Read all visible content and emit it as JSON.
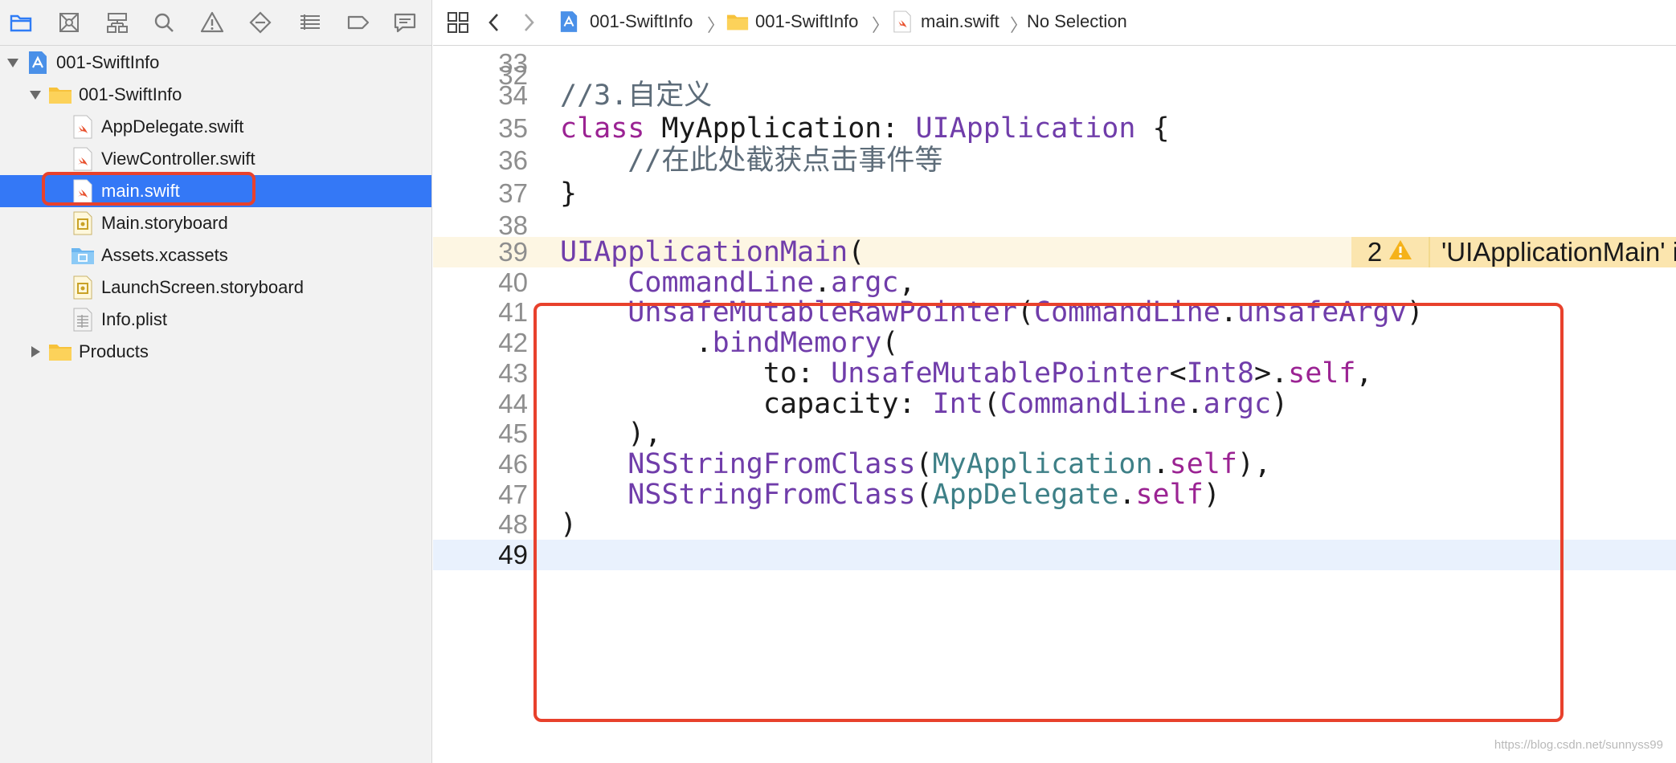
{
  "navigator": {
    "toolbar_icons": [
      "folder-icon",
      "source-control-icon",
      "hierarchy-icon",
      "search-icon",
      "warning-icon",
      "breakpoint-icon",
      "debug-list-icon",
      "tag-icon",
      "chat-icon"
    ],
    "tree": [
      {
        "label": "001-SwiftInfo",
        "icon": "project-icon",
        "disclosure": "expanded"
      },
      {
        "label": "001-SwiftInfo",
        "icon": "folder-icon",
        "disclosure": "expanded"
      },
      {
        "label": "AppDelegate.swift",
        "icon": "swift-file-icon"
      },
      {
        "label": "ViewController.swift",
        "icon": "swift-file-icon"
      },
      {
        "label": "main.swift",
        "icon": "swift-file-icon",
        "selected": true
      },
      {
        "label": "Main.storyboard",
        "icon": "storyboard-icon"
      },
      {
        "label": "Assets.xcassets",
        "icon": "asset-catalog-icon"
      },
      {
        "label": "LaunchScreen.storyboard",
        "icon": "storyboard-icon"
      },
      {
        "label": "Info.plist",
        "icon": "plist-icon"
      },
      {
        "label": "Products",
        "icon": "folder-icon",
        "disclosure": "collapsed"
      }
    ]
  },
  "jumpbar": {
    "crumbs": [
      "001-SwiftInfo",
      "001-SwiftInfo",
      "main.swift",
      "No Selection"
    ]
  },
  "editor": {
    "partial_top_line": "32",
    "lines": [
      {
        "n": "33",
        "tokens": []
      },
      {
        "n": "34",
        "tokens": [
          {
            "t": "//3.自定义",
            "c": "cmt"
          }
        ]
      },
      {
        "n": "35",
        "tokens": [
          {
            "t": "class",
            "c": "kw"
          },
          {
            "t": " MyApplication: ",
            "c": "plain"
          },
          {
            "t": "UIApplication",
            "c": "type"
          },
          {
            "t": " {",
            "c": "plain"
          }
        ]
      },
      {
        "n": "36",
        "tokens": [
          {
            "t": "    //在此处截获点击事件等",
            "c": "cmt"
          }
        ]
      },
      {
        "n": "37",
        "tokens": [
          {
            "t": "}",
            "c": "plain"
          }
        ]
      },
      {
        "n": "38",
        "tokens": []
      },
      {
        "n": "39",
        "warn": true,
        "tokens": [
          {
            "t": "UIApplicationMain",
            "c": "type"
          },
          {
            "t": "(",
            "c": "plain"
          }
        ]
      },
      {
        "n": "40",
        "tokens": [
          {
            "t": "    ",
            "c": "plain"
          },
          {
            "t": "CommandLine",
            "c": "type"
          },
          {
            "t": ".",
            "c": "plain"
          },
          {
            "t": "argc",
            "c": "type"
          },
          {
            "t": ",",
            "c": "plain"
          }
        ]
      },
      {
        "n": "41",
        "tokens": [
          {
            "t": "    ",
            "c": "plain"
          },
          {
            "t": "UnsafeMutableRawPointer",
            "c": "type"
          },
          {
            "t": "(",
            "c": "plain"
          },
          {
            "t": "CommandLine",
            "c": "type"
          },
          {
            "t": ".",
            "c": "plain"
          },
          {
            "t": "unsafeArgv",
            "c": "type"
          },
          {
            "t": ")",
            "c": "plain"
          }
        ]
      },
      {
        "n": "42",
        "tokens": [
          {
            "t": "        .",
            "c": "plain"
          },
          {
            "t": "bindMemory",
            "c": "type"
          },
          {
            "t": "(",
            "c": "plain"
          }
        ]
      },
      {
        "n": "43",
        "tokens": [
          {
            "t": "            to: ",
            "c": "plain"
          },
          {
            "t": "UnsafeMutablePointer",
            "c": "type"
          },
          {
            "t": "<",
            "c": "plain"
          },
          {
            "t": "Int8",
            "c": "type"
          },
          {
            "t": ">.",
            "c": "plain"
          },
          {
            "t": "self",
            "c": "kw"
          },
          {
            "t": ",",
            "c": "plain"
          }
        ]
      },
      {
        "n": "44",
        "tokens": [
          {
            "t": "            capacity: ",
            "c": "plain"
          },
          {
            "t": "Int",
            "c": "type"
          },
          {
            "t": "(",
            "c": "plain"
          },
          {
            "t": "CommandLine",
            "c": "type"
          },
          {
            "t": ".",
            "c": "plain"
          },
          {
            "t": "argc",
            "c": "type"
          },
          {
            "t": ")",
            "c": "plain"
          }
        ]
      },
      {
        "n": "45",
        "tokens": [
          {
            "t": "    ),",
            "c": "plain"
          }
        ]
      },
      {
        "n": "46",
        "tokens": [
          {
            "t": "    ",
            "c": "plain"
          },
          {
            "t": "NSStringFromClass",
            "c": "type"
          },
          {
            "t": "(",
            "c": "plain"
          },
          {
            "t": "MyApplication",
            "c": "cls"
          },
          {
            "t": ".",
            "c": "plain"
          },
          {
            "t": "self",
            "c": "kw"
          },
          {
            "t": "),",
            "c": "plain"
          }
        ]
      },
      {
        "n": "47",
        "tokens": [
          {
            "t": "    ",
            "c": "plain"
          },
          {
            "t": "NSStringFromClass",
            "c": "type"
          },
          {
            "t": "(",
            "c": "plain"
          },
          {
            "t": "AppDelegate",
            "c": "cls"
          },
          {
            "t": ".",
            "c": "plain"
          },
          {
            "t": "self",
            "c": "kw"
          },
          {
            "t": ")",
            "c": "plain"
          }
        ]
      },
      {
        "n": "48",
        "tokens": [
          {
            "t": ")",
            "c": "plain"
          }
        ]
      },
      {
        "n": "49",
        "current": true,
        "tokens": []
      }
    ],
    "warning": {
      "count": "2",
      "message": "'UIApplicationMain' is deprecated: Use the overloa"
    }
  },
  "watermark": "https://blog.csdn.net/sunnyss99",
  "colors": {
    "selection": "#3478f6",
    "highlight_box": "#e8412c",
    "warning_bg": "#fbe5ae",
    "keyword": "#9b2393",
    "type": "#703daa",
    "class": "#3e8087",
    "comment": "#5d6c79"
  }
}
